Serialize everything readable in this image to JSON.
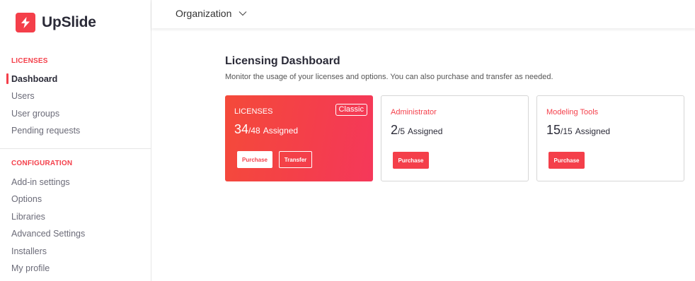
{
  "app": {
    "name": "UpSlide"
  },
  "header": {
    "organization_label": "Organization"
  },
  "sidebar": {
    "licenses_title": "LICENSES",
    "licenses_items": [
      {
        "label": "Dashboard",
        "active": true
      },
      {
        "label": "Users"
      },
      {
        "label": "User groups"
      },
      {
        "label": "Pending requests"
      }
    ],
    "configuration_title": "CONFIGURATION",
    "configuration_items": [
      {
        "label": "Add-in settings"
      },
      {
        "label": "Options"
      },
      {
        "label": "Libraries"
      },
      {
        "label": "Advanced Settings"
      },
      {
        "label": "Installers"
      },
      {
        "label": "My profile"
      }
    ]
  },
  "main": {
    "title": "Licensing Dashboard",
    "subtitle": "Monitor the usage of your licenses and options. You can also purchase and transfer as needed.",
    "cards": [
      {
        "label": "LICENSES",
        "badge": "Classic",
        "assigned": "34",
        "total": "/48",
        "assigned_label": "Assigned",
        "purchase_label": "Purchase",
        "transfer_label": "Transfer"
      },
      {
        "label": "Administrator",
        "assigned": "2",
        "total": "/5",
        "assigned_label": "Assigned",
        "purchase_label": "Purchase"
      },
      {
        "label": "Modeling Tools",
        "assigned": "15",
        "total": "/15",
        "assigned_label": "Assigned",
        "purchase_label": "Purchase"
      }
    ]
  },
  "colors": {
    "accent": "#f43f4a",
    "text_dark": "#2b2b38",
    "text_muted": "#6b6b78"
  },
  "icons": {
    "logo": "upslide-bolt-icon",
    "dropdown": "chevron-down-icon"
  }
}
